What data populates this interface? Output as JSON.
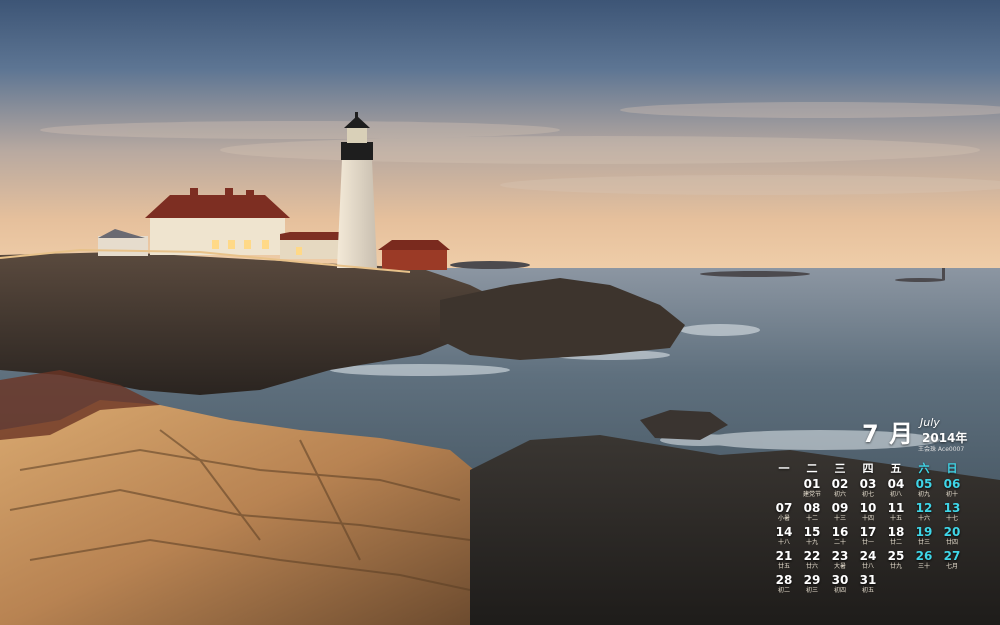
{
  "calendar": {
    "month_number": "7",
    "month_cn": "月",
    "month_en": "July",
    "year": "2014年",
    "credit": "王会珠 Ace0007",
    "weekdays": [
      "一",
      "二",
      "三",
      "四",
      "五",
      "六",
      "日"
    ],
    "weeks": [
      [
        {
          "d": "",
          "l": ""
        },
        {
          "d": "01",
          "l": "建党节"
        },
        {
          "d": "02",
          "l": "初六"
        },
        {
          "d": "03",
          "l": "初七"
        },
        {
          "d": "04",
          "l": "初八"
        },
        {
          "d": "05",
          "l": "初九"
        },
        {
          "d": "06",
          "l": "初十"
        }
      ],
      [
        {
          "d": "07",
          "l": "小暑"
        },
        {
          "d": "08",
          "l": "十二"
        },
        {
          "d": "09",
          "l": "十三"
        },
        {
          "d": "10",
          "l": "十四"
        },
        {
          "d": "11",
          "l": "十五"
        },
        {
          "d": "12",
          "l": "十六"
        },
        {
          "d": "13",
          "l": "十七"
        }
      ],
      [
        {
          "d": "14",
          "l": "十八"
        },
        {
          "d": "15",
          "l": "十九"
        },
        {
          "d": "16",
          "l": "二十"
        },
        {
          "d": "17",
          "l": "廿一"
        },
        {
          "d": "18",
          "l": "廿二"
        },
        {
          "d": "19",
          "l": "廿三"
        },
        {
          "d": "20",
          "l": "廿四"
        }
      ],
      [
        {
          "d": "21",
          "l": "廿五"
        },
        {
          "d": "22",
          "l": "廿六"
        },
        {
          "d": "23",
          "l": "大暑"
        },
        {
          "d": "24",
          "l": "廿八"
        },
        {
          "d": "25",
          "l": "廿九"
        },
        {
          "d": "26",
          "l": "三十"
        },
        {
          "d": "27",
          "l": "七月"
        }
      ],
      [
        {
          "d": "28",
          "l": "初二"
        },
        {
          "d": "29",
          "l": "初三"
        },
        {
          "d": "30",
          "l": "初四"
        },
        {
          "d": "31",
          "l": "初五"
        },
        {
          "d": "",
          "l": ""
        },
        {
          "d": "",
          "l": ""
        },
        {
          "d": "",
          "l": ""
        }
      ]
    ]
  },
  "colors": {
    "weekend_accent": "#3fd6e8",
    "sky_top": "#3f587a",
    "sky_horizon": "#f0c9a2",
    "sea": "#4a5e6e"
  }
}
